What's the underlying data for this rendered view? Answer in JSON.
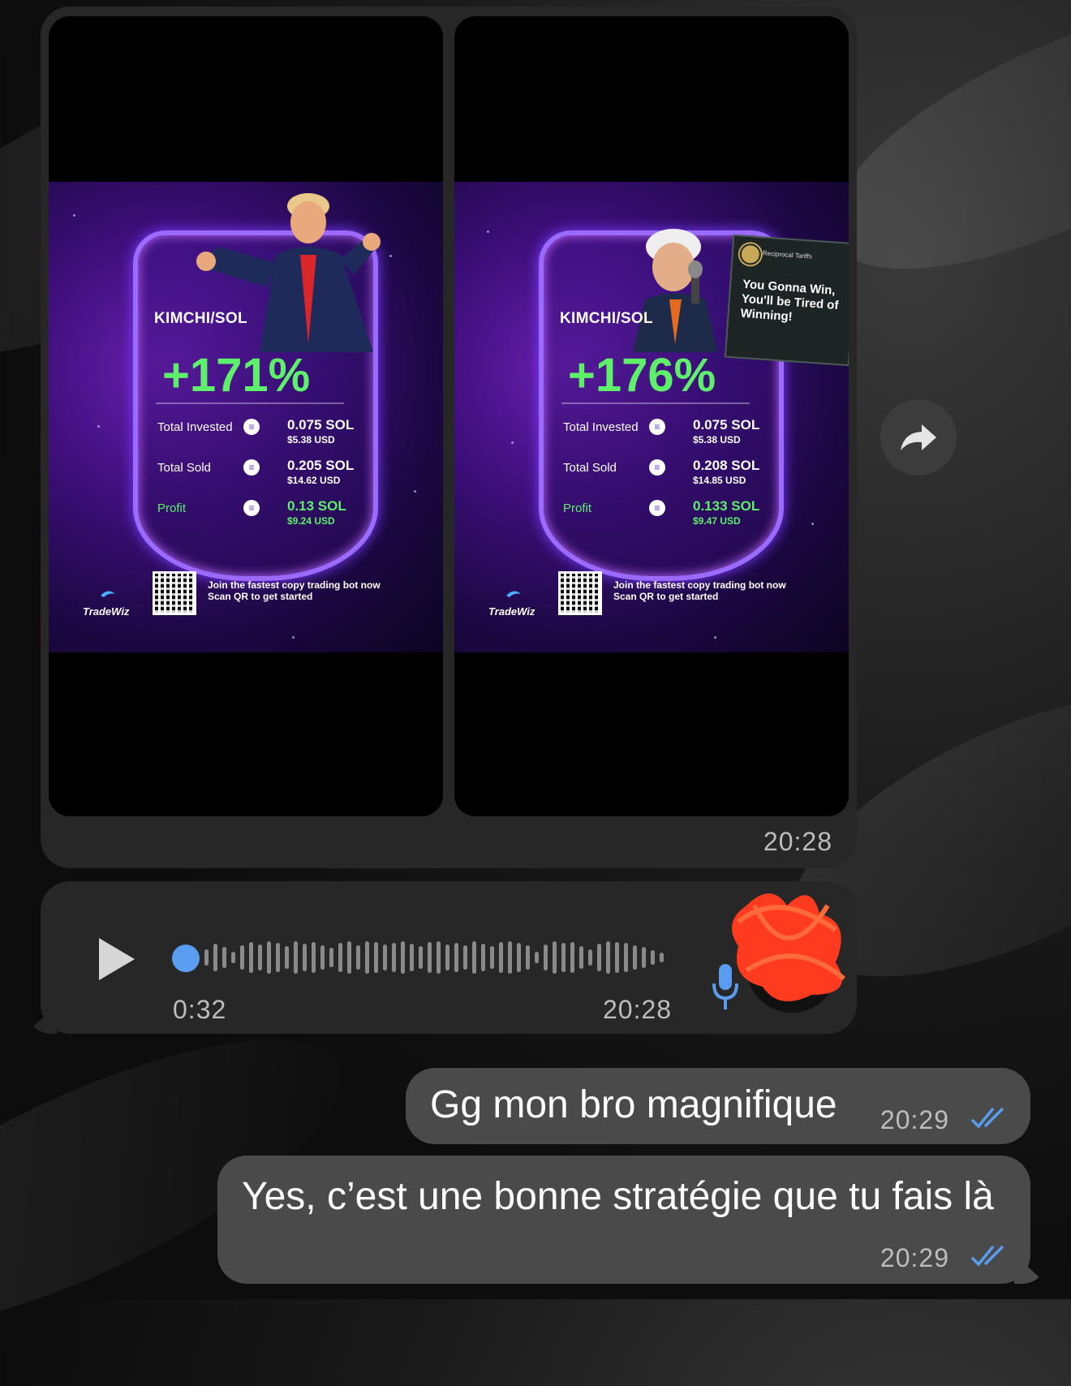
{
  "album": {
    "cards": [
      {
        "pair": "KIMCHI/SOL",
        "percent": "+171%",
        "rows": [
          {
            "label": "Total Invested",
            "sol": "0.075 SOL",
            "usd": "$5.38 USD",
            "profit": false
          },
          {
            "label": "Total Sold",
            "sol": "0.205 SOL",
            "usd": "$14.62 USD",
            "profit": false
          },
          {
            "label": "Profit",
            "sol": "0.13 SOL",
            "usd": "$9.24 USD",
            "profit": true
          }
        ],
        "join_line1": "Join the fastest copy trading bot now",
        "join_line2": "Scan QR to get started",
        "brand": "TradeWiz"
      },
      {
        "pair": "KIMCHI/SOL",
        "percent": "+176%",
        "rows": [
          {
            "label": "Total Invested",
            "sol": "0.075 SOL",
            "usd": "$5.38 USD",
            "profit": false
          },
          {
            "label": "Total Sold",
            "sol": "0.208 SOL",
            "usd": "$14.85 USD",
            "profit": false
          },
          {
            "label": "Profit",
            "sol": "0.133 SOL",
            "usd": "$9.47 USD",
            "profit": true
          }
        ],
        "join_line1": "Join the fastest copy trading bot now",
        "join_line2": "Scan QR to get started",
        "brand": "TradeWiz",
        "sign_header": "Reciprocal Tariffs",
        "sign_text": "You Gonna Win, You'll be Tired of Winning!"
      }
    ],
    "time": "20:28"
  },
  "voice": {
    "duration": "0:32",
    "time": "20:28",
    "play_icon": "play-icon",
    "mic_icon": "microphone-icon",
    "accent": "#5a9cf0"
  },
  "messages": [
    {
      "text": "Gg mon bro magnifique",
      "time": "20:29",
      "status": "read"
    },
    {
      "text": "Yes, c’est une bonne stratégie que tu fais là",
      "time": "20:29",
      "status": "read"
    }
  ],
  "colors": {
    "incoming_bubble": "#272727",
    "outgoing_bubble": "#4a4a4a",
    "profit_green": "#5ef06a",
    "read_ticks": "#5a9cf0"
  }
}
